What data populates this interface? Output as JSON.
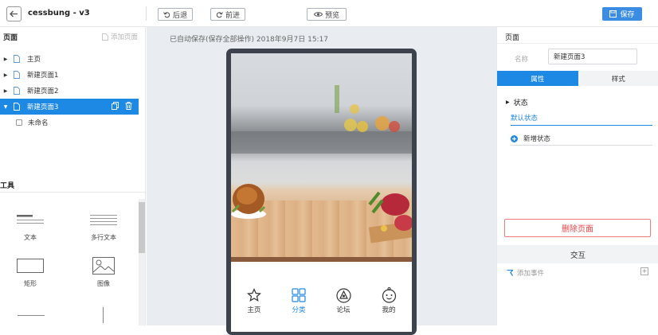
{
  "header": {
    "title": "cessbung - v3",
    "undo_label": "后退",
    "redo_label": "前进",
    "preview_label": "预览",
    "save_label": "保存"
  },
  "left_panel": {
    "title": "页面",
    "add_page_label": "添加页面",
    "pages": [
      {
        "label": "主页"
      },
      {
        "label": "新建页面1"
      },
      {
        "label": "新建页面2"
      },
      {
        "label": "新建页面3"
      }
    ],
    "sub_item": "未命名",
    "tools_title": "工具",
    "tools": [
      {
        "label": "文本",
        "icon": "text-icon"
      },
      {
        "label": "多行文本",
        "icon": "multiline-text-icon"
      },
      {
        "label": "矩形",
        "icon": "rectangle-icon"
      },
      {
        "label": "图像",
        "icon": "image-icon"
      }
    ]
  },
  "canvas": {
    "autosave_text": "已自动保存(保存全部操作) 2018年9月7日 15:17",
    "nav_items": [
      {
        "label": "主页",
        "icon": "star-icon"
      },
      {
        "label": "分类",
        "icon": "grid-icon"
      },
      {
        "label": "论坛",
        "icon": "compass-icon"
      },
      {
        "label": "我的",
        "icon": "face-icon"
      }
    ]
  },
  "right_panel": {
    "title": "页面",
    "name_label": "名称",
    "name_value": "新建页面3",
    "tab_properties": "属性",
    "tab_style": "样式",
    "state_title": "状态",
    "default_state": "默认状态",
    "add_state": "新增状态",
    "delete_page": "删除页面",
    "interaction_title": "交互",
    "add_event": "添加事件"
  },
  "colors": {
    "accent": "#1e88e5",
    "danger": "#e64545",
    "canvas_bg": "#e9ecf1"
  }
}
